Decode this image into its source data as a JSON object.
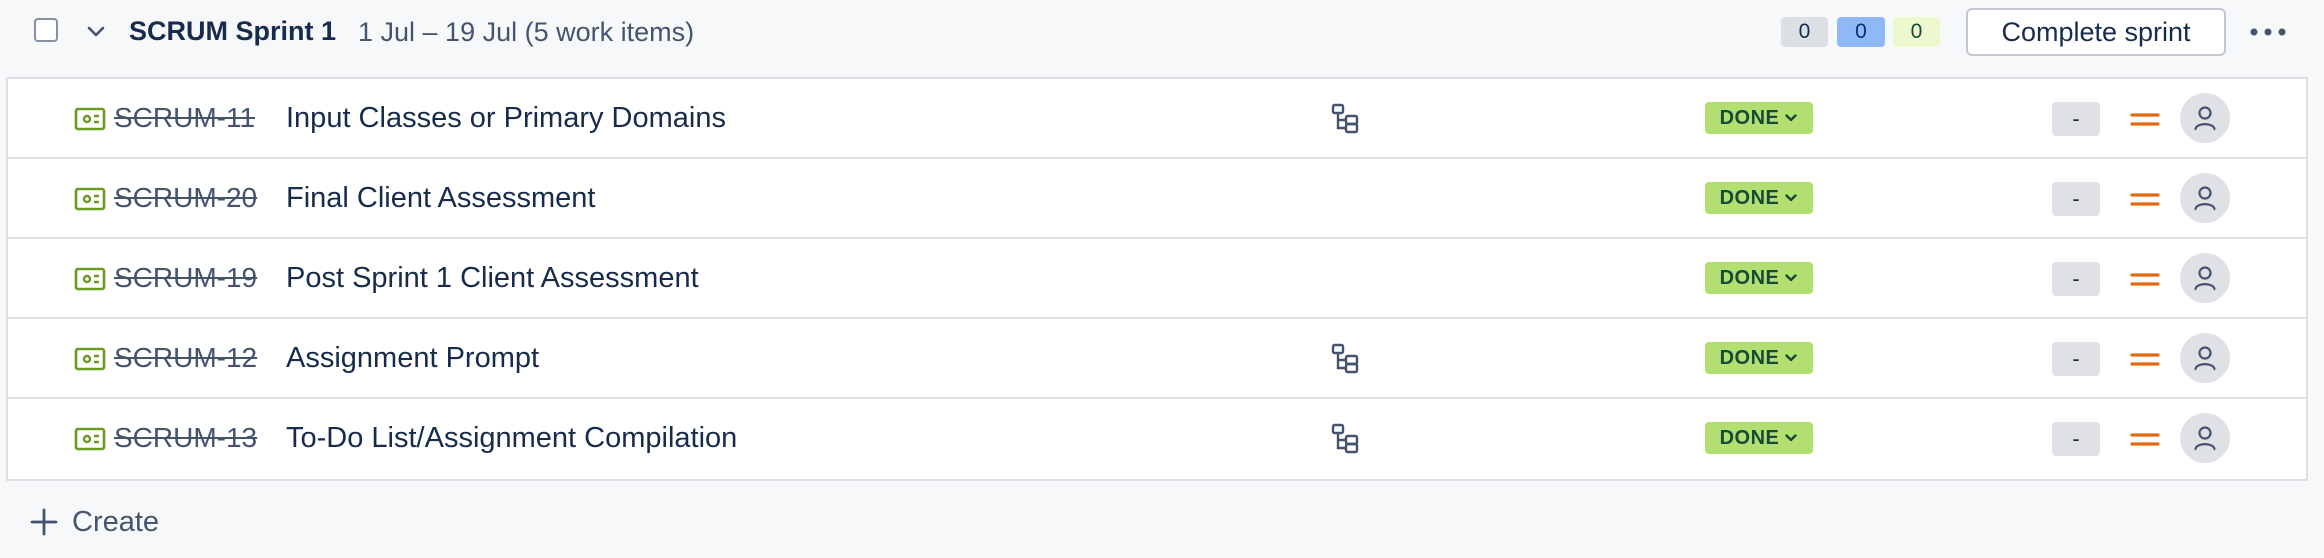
{
  "sprint": {
    "name": "SCRUM Sprint 1",
    "dates": "1 Jul – 19 Jul (5 work items)",
    "counts": {
      "todo": "0",
      "in_progress": "0",
      "done": "0"
    },
    "complete_button_label": "Complete sprint",
    "more_icon": "ellipsis-icon"
  },
  "items": [
    {
      "key": "SCRUM-11",
      "summary": "Input Classes or Primary Domains",
      "has_children": true,
      "status": "DONE",
      "estimate": "-"
    },
    {
      "key": "SCRUM-20",
      "summary": "Final Client Assessment",
      "has_children": false,
      "status": "DONE",
      "estimate": "-"
    },
    {
      "key": "SCRUM-19",
      "summary": "Post Sprint 1 Client Assessment",
      "has_children": false,
      "status": "DONE",
      "estimate": "-"
    },
    {
      "key": "SCRUM-12",
      "summary": "Assignment Prompt",
      "has_children": true,
      "status": "DONE",
      "estimate": "-"
    },
    {
      "key": "SCRUM-13",
      "summary": "To-Do List/Assignment Compilation",
      "has_children": true,
      "status": "DONE",
      "estimate": "-"
    }
  ],
  "create_label": "Create",
  "colors": {
    "story_icon": "#6a9a23",
    "status_done_bg": "#b3df72",
    "priority_medium": "#e56910",
    "count_inprogress_bg": "#8fb8f6",
    "count_done_bg": "#eef8cf"
  }
}
